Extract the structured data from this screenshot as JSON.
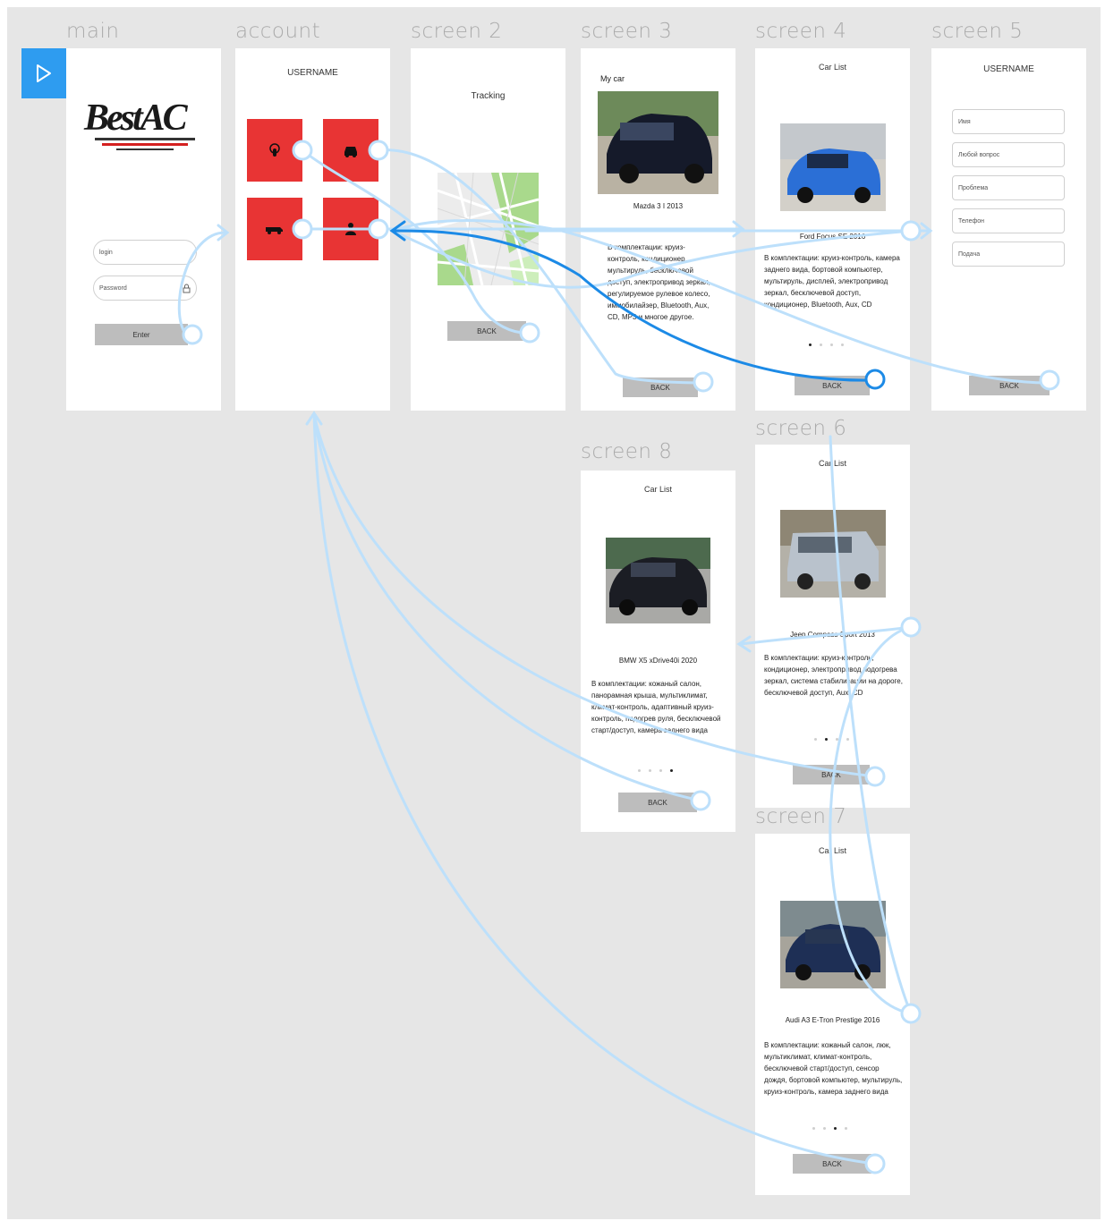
{
  "colors": {
    "canvas": "#e6e6e6",
    "accent": "#2e9cf0",
    "tile_red": "#e83434",
    "link_light": "#bde0fb",
    "link_active": "#1c8ae6"
  },
  "play_icon": "play-icon",
  "artboards": {
    "main": {
      "label": "main",
      "logo_text": "BestAC",
      "login_placeholder": "login",
      "password_placeholder": "Password",
      "enter_label": "Enter"
    },
    "account": {
      "label": "account",
      "title": "USERNAME",
      "tiles": [
        "hand-tap-icon",
        "car-icon",
        "tow-truck-icon",
        "person-icon"
      ]
    },
    "screen2": {
      "label": "screen 2",
      "title": "Tracking",
      "back_label": "BACK"
    },
    "screen3": {
      "label": "screen 3",
      "title": "My car",
      "car_name": "Mazda 3 I 2013",
      "description": "В комплектации: круиз-контроль, кондиционер, мультируль, бесключевой доступ, электропривод зеркал, регулируемое рулевое колесо, иммобилайзер, Bluetooth, Aux, CD, MP3 и многое другое.",
      "back_label": "BACK"
    },
    "screen4": {
      "label": "screen 4",
      "title": "Car List",
      "car_name": "Ford Focus SE 2016",
      "description": "В комплектации: круиз-контроль, камера заднего вида, бортовой компьютер, мультируль, дисплей, электропривод зеркал, бесключевой доступ, кондиционер, Bluetooth, Aux, CD",
      "back_label": "BACK"
    },
    "screen5": {
      "label": "screen 5",
      "title": "USERNAME",
      "fields": [
        "Имя",
        "Любой вопрос",
        "Проблема",
        "Телефон",
        "Подача"
      ],
      "back_label": "BACK"
    },
    "screen6": {
      "label": "screen 6",
      "title": "Car List",
      "car_name": "Jeep Compass Sport 2013",
      "description": "В комплектации: круиз-контроль, кондиционер, электропривод подогрева зеркал, система стабилизации на дороге, бесключевой доступ, Aux, CD",
      "back_label": "BACK"
    },
    "screen7": {
      "label": "screen 7",
      "title": "Car List",
      "car_name": "Audi A3 E-Tron Prestige 2016",
      "description": "В комплектации: кожаный салон, люк, мультиклимат, климат-контроль, бесключевой старт/доступ, сенсор дождя, бортовой компьютер, мультируль, круиз-контроль, камера заднего вида",
      "back_label": "BACK"
    },
    "screen8": {
      "label": "screen 8",
      "title": "Car List",
      "car_name": "BMW X5 xDrive40i 2020",
      "description": "В комплектации: кожаный салон, панорамная крыша, мультиклимат, климат-контроль, адаптивный круиз-контроль, подогрев руля, бесключевой старт/доступ, камера заднего вида",
      "back_label": "BACK"
    }
  }
}
